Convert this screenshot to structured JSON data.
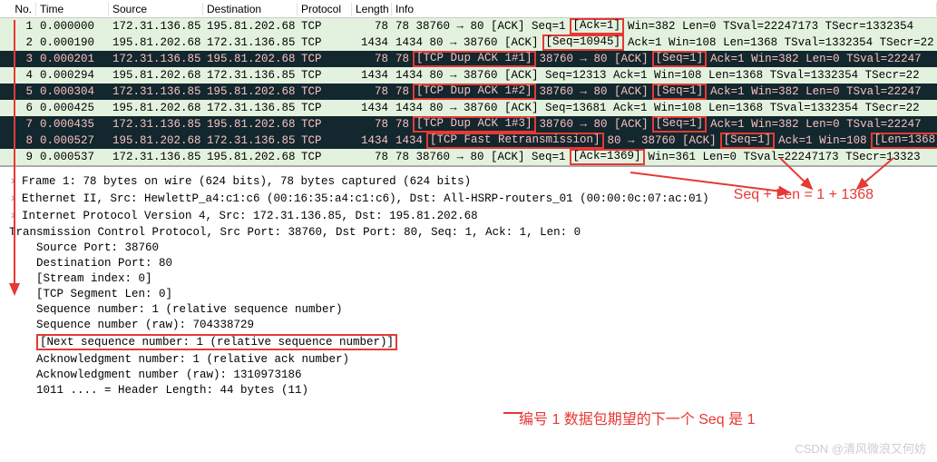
{
  "columns": {
    "no": "No.",
    "time": "Time",
    "src": "Source",
    "dst": "Destination",
    "proto": "Protocol",
    "len": "Length",
    "info": "Info"
  },
  "packets": [
    {
      "no": "1",
      "time": "0.000000",
      "src": "172.31.136.85",
      "dst": "195.81.202.68",
      "proto": "TCP",
      "len": "78",
      "bg": "green",
      "info": [
        "78 38760 → 80 [ACK] Seq=1 ",
        "[Ack=1]",
        " Win=382 Len=0 TSval=22247173 TSecr=1332354"
      ],
      "boxed": [
        false,
        true,
        false
      ]
    },
    {
      "no": "2",
      "time": "0.000190",
      "src": "195.81.202.68",
      "dst": "172.31.136.85",
      "proto": "TCP",
      "len": "1434",
      "bg": "green",
      "info": [
        "1434 80 → 38760 [ACK] ",
        "[Seq=10945]",
        " Ack=1 Win=108 Len=1368 TSval=1332354 TSecr=22"
      ],
      "boxed": [
        false,
        true,
        false
      ]
    },
    {
      "no": "3",
      "time": "0.000201",
      "src": "172.31.136.85",
      "dst": "195.81.202.68",
      "proto": "TCP",
      "len": "78",
      "bg": "dark",
      "info": [
        "78 ",
        "[TCP Dup ACK 1#1]",
        " 38760 → 80 [ACK] ",
        "[Seq=1]",
        " Ack=1 Win=382 Len=0 TSval=22247"
      ],
      "boxed": [
        false,
        true,
        false,
        true,
        false
      ]
    },
    {
      "no": "4",
      "time": "0.000294",
      "src": "195.81.202.68",
      "dst": "172.31.136.85",
      "proto": "TCP",
      "len": "1434",
      "bg": "green",
      "info": [
        "1434 80 → 38760 [ACK] Seq=12313 Ack=1 Win=108 Len=1368 TSval=1332354 TSecr=22"
      ],
      "boxed": [
        false
      ]
    },
    {
      "no": "5",
      "time": "0.000304",
      "src": "172.31.136.85",
      "dst": "195.81.202.68",
      "proto": "TCP",
      "len": "78",
      "bg": "dark",
      "info": [
        "78 ",
        "[TCP Dup ACK 1#2]",
        " 38760 → 80 [ACK] ",
        "[Seq=1]",
        " Ack=1 Win=382 Len=0 TSval=22247"
      ],
      "boxed": [
        false,
        true,
        false,
        true,
        false
      ]
    },
    {
      "no": "6",
      "time": "0.000425",
      "src": "195.81.202.68",
      "dst": "172.31.136.85",
      "proto": "TCP",
      "len": "1434",
      "bg": "green",
      "info": [
        "1434 80 → 38760 [ACK] Seq=13681 Ack=1 Win=108 Len=1368 TSval=1332354 TSecr=22"
      ],
      "boxed": [
        false
      ]
    },
    {
      "no": "7",
      "time": "0.000435",
      "src": "172.31.136.85",
      "dst": "195.81.202.68",
      "proto": "TCP",
      "len": "78",
      "bg": "dark",
      "info": [
        "78 ",
        "[TCP Dup ACK 1#3]",
        " 38760 → 80 [ACK] ",
        "[Seq=1]",
        " Ack=1 Win=382 Len=0 TSval=22247"
      ],
      "boxed": [
        false,
        true,
        false,
        true,
        false
      ]
    },
    {
      "no": "8",
      "time": "0.000527",
      "src": "195.81.202.68",
      "dst": "172.31.136.85",
      "proto": "TCP",
      "len": "1434",
      "bg": "dark",
      "info": [
        "1434 ",
        "[TCP Fast Retransmission]",
        " 80 → 38760 [ACK] ",
        "[Seq=1]",
        " Ack=1 Win=108 ",
        "[Len=1368]"
      ],
      "boxed": [
        false,
        true,
        false,
        true,
        false,
        true
      ]
    },
    {
      "no": "9",
      "time": "0.000537",
      "src": "172.31.136.85",
      "dst": "195.81.202.68",
      "proto": "TCP",
      "len": "78",
      "bg": "green",
      "info": [
        "78 38760 → 80 [ACK] Seq=1 ",
        "[Ack=1369]",
        " Win=361 Len=0 TSval=22247173 TSecr=13323"
      ],
      "boxed": [
        false,
        true,
        false
      ]
    }
  ],
  "tree": {
    "frame": "Frame 1: 78 bytes on wire (624 bits), 78 bytes captured (624 bits)",
    "eth": "Ethernet II, Src: HewlettP_a4:c1:c6 (00:16:35:a4:c1:c6), Dst: All-HSRP-routers_01 (00:00:0c:07:ac:01)",
    "ip": "Internet Protocol Version 4, Src: 172.31.136.85, Dst: 195.81.202.68",
    "tcp": "Transmission Control Protocol, Src Port: 38760, Dst Port: 80, Seq: 1, Ack: 1, Len: 0",
    "srcport": "Source Port: 38760",
    "dstport": "Destination Port: 80",
    "stream": "[Stream index: 0]",
    "seglen": "[TCP Segment Len: 0]",
    "seqnum": "Sequence number: 1    (relative sequence number)",
    "seqraw": "Sequence number (raw): 704338729",
    "nextseq": "[Next sequence number: 1    (relative sequence number)]",
    "acknum": "Acknowledgment number: 1    (relative ack number)",
    "ackraw": "Acknowledgment number (raw): 1310973186",
    "hdrlen": "1011 .... = Header Length: 44 bytes (11)"
  },
  "annotations": {
    "formula": "Seq + Len = 1 + 1368",
    "nextseq_note": "编号 1 数据包期望的下一个 Seq 是 1"
  },
  "watermark": "CSDN @清风微浪又何妨"
}
